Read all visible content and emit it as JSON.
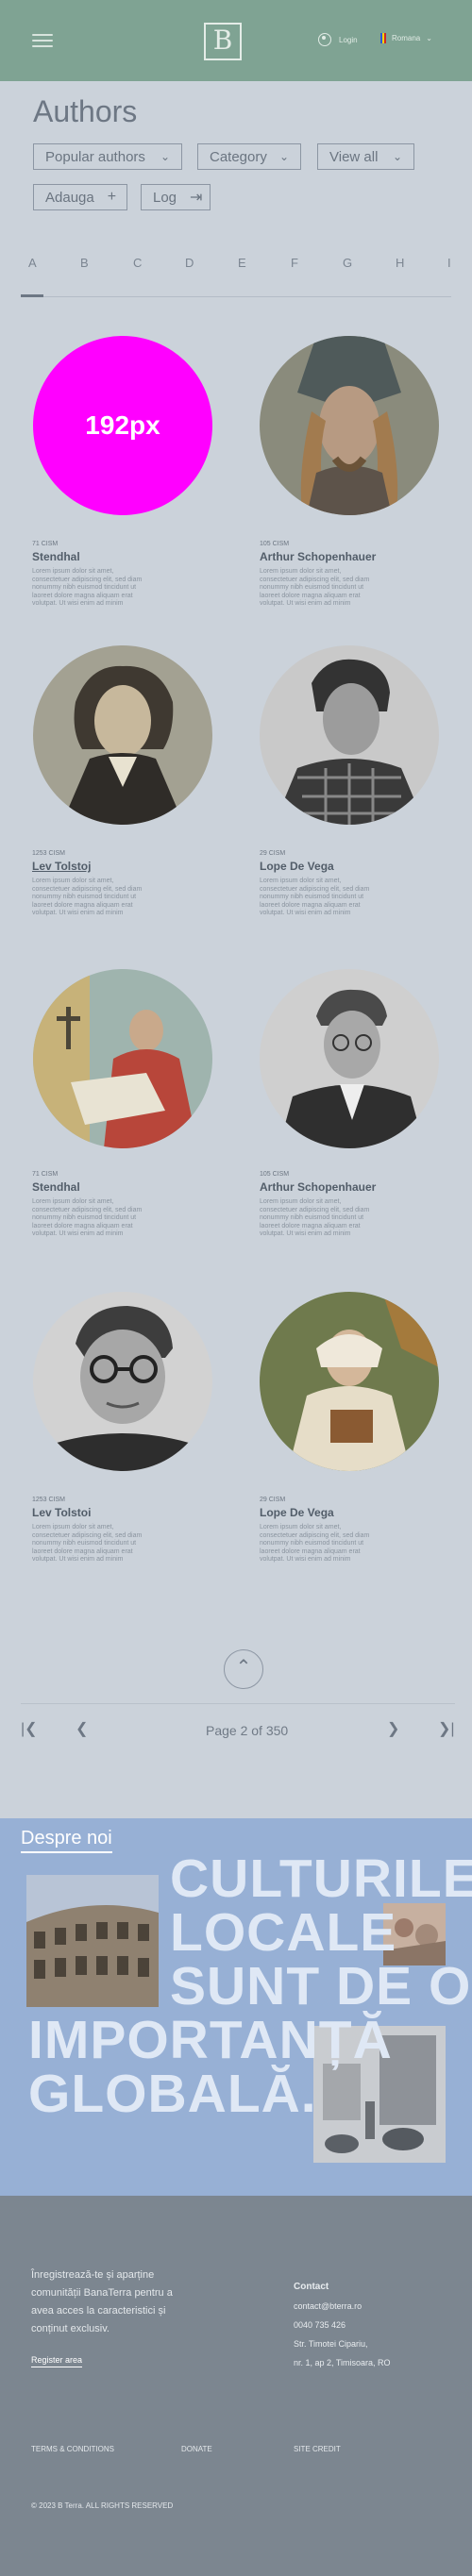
{
  "header": {
    "logo_text": "B",
    "login_label": "Login",
    "language_label": "Romana",
    "flag_colors": [
      "#2a5bd7",
      "#f5d20a",
      "#cc2a2a"
    ]
  },
  "page": {
    "title": "Authors",
    "filters": {
      "popular": "Popular authors",
      "category": "Category",
      "view_all": "View all",
      "adauga": "Adauga",
      "log": "Log"
    }
  },
  "alphabet": [
    "A",
    "B",
    "C",
    "D",
    "E",
    "F",
    "G",
    "H",
    "I"
  ],
  "authors": [
    {
      "years": "71 CISM",
      "name": "Stendhal",
      "image": "192px",
      "desc": "Lorem ipsum dolor sit amet, consectetuer adipiscing elit, sed diam nonummy nibh euismod tincidunt ut laoreet dolore magna aliquam erat volutpat. Ut wisi enim ad minim"
    },
    {
      "years": "105 CISM",
      "name": "Arthur  Schopenhauer",
      "desc": "Lorem ipsum dolor sit amet, consectetuer adipiscing elit, sed diam nonummy nibh euismod tincidunt ut laoreet dolore magna aliquam erat volutpat. Ut wisi enim ad minim"
    },
    {
      "years": "1253 CISM",
      "name": "Lev Tolstoj",
      "desc": "Lorem ipsum dolor sit amet, consectetuer adipiscing elit, sed diam nonummy nibh euismod tincidunt ut laoreet dolore magna aliquam erat volutpat. Ut wisi enim ad minim"
    },
    {
      "years": "29 CISM",
      "name": "Lope De Vega",
      "desc": "Lorem ipsum dolor sit amet, consectetuer adipiscing elit, sed diam nonummy nibh euismod tincidunt ut laoreet dolore magna aliquam erat volutpat. Ut wisi enim ad minim"
    },
    {
      "years": "71 CISM",
      "name": "Stendhal",
      "desc": "Lorem ipsum dolor sit amet, consectetuer adipiscing elit, sed diam nonummy nibh euismod tincidunt ut laoreet dolore magna aliquam erat volutpat. Ut wisi enim ad minim"
    },
    {
      "years": "105 CISM",
      "name": "Arthur  Schopenhauer",
      "desc": "Lorem ipsum dolor sit amet, consectetuer adipiscing elit, sed diam nonummy nibh euismod tincidunt ut laoreet dolore magna aliquam erat volutpat. Ut wisi enim ad minim"
    },
    {
      "years": "1253 CISM",
      "name": "Lev Tolstoi",
      "desc": "Lorem ipsum dolor sit amet, consectetuer adipiscing elit, sed diam nonummy nibh euismod tincidunt ut laoreet dolore magna aliquam erat volutpat. Ut wisi enim ad minim"
    },
    {
      "years": "29 CISM",
      "name": "Lope De Vega",
      "desc": "Lorem ipsum dolor sit amet, consectetuer adipiscing elit, sed diam nonummy nibh euismod tincidunt ut laoreet dolore magna aliquam erat volutpat. Ut wisi enim ad minim"
    }
  ],
  "pagination": {
    "text": "Page 2 of 350"
  },
  "about": {
    "title": "Despre noi",
    "slogan_lines": [
      "CULTURILE",
      "LOCALE",
      "SUNT DE O",
      "IMPORTANȚĂ",
      "GLOBALĂ."
    ]
  },
  "footer": {
    "register_text": "Înregistrează-te și aparține comunității BanaTerra pentru a avea acces la caracteristici și conținut exclusiv.",
    "register_link": "Register area",
    "contact_title": "Contact",
    "contact_email": "contact@bterra.ro",
    "contact_phone": "0040 735 426",
    "contact_street": "Str. Timotei Cipariu,",
    "contact_city": "nr. 1, ap 2, Timisoara, RO",
    "links": [
      "TERMS & CONDITIONS",
      "DONATE",
      "SITE CREDIT"
    ],
    "copyright": "© 2023 B Terra. ALL RIGHTS RESERVED"
  }
}
